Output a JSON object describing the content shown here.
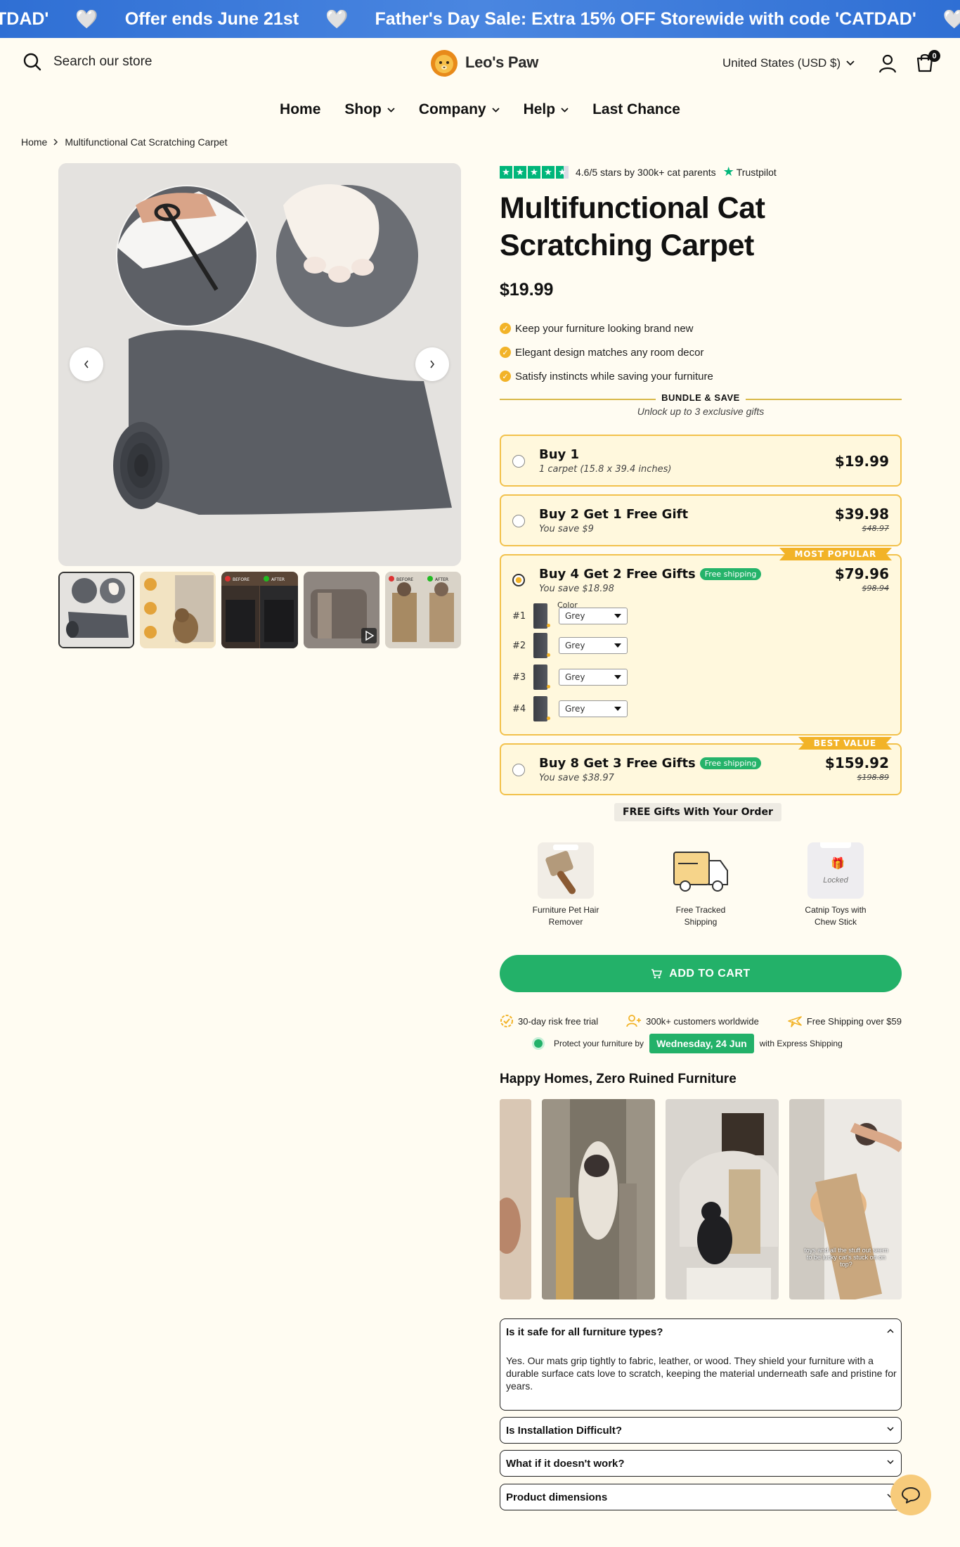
{
  "announcement": {
    "items": [
      "TDAD'",
      "Offer ends June 21st",
      "Father's Day Sale: Extra 15% OFF Storewide with code 'CATDAD'"
    ],
    "heart": "🤍"
  },
  "header": {
    "search_placeholder": "Search our store",
    "logo_text": "Leo's Paw",
    "currency": "United States (USD $)",
    "cart_count": "0"
  },
  "nav": [
    {
      "label": "Home",
      "dropdown": false
    },
    {
      "label": "Shop",
      "dropdown": true
    },
    {
      "label": "Company",
      "dropdown": true
    },
    {
      "label": "Help",
      "dropdown": true
    },
    {
      "label": "Last Chance",
      "dropdown": false
    }
  ],
  "breadcrumb": {
    "home": "Home",
    "current": "Multifunctional Cat Scratching Carpet"
  },
  "product": {
    "rating_text": "4.6/5 stars by 300k+ cat parents",
    "trustpilot": "Trustpilot",
    "title": "Multifunctional Cat Scratching Carpet",
    "price": "$19.99",
    "benefits": [
      "Keep your furniture looking brand new",
      "Elegant design matches any room decor",
      "Satisfy instincts while saving your furniture"
    ]
  },
  "bundle": {
    "title": "BUNDLE & SAVE",
    "subtitle": "Unlock up to 3 exclusive gifts",
    "options": [
      {
        "title": "Buy 1",
        "sub": "1 carpet (15.8 x 39.4 inches)",
        "price": "$19.99",
        "old": "",
        "badge": "",
        "ribbon": "",
        "selected": false
      },
      {
        "title": "Buy 2 Get 1 Free Gift",
        "sub": "You save $9",
        "price": "$39.98",
        "old": "$48.97",
        "badge": "",
        "ribbon": "",
        "selected": false
      },
      {
        "title": "Buy 4 Get 2 Free Gifts",
        "sub": "You save $18.98",
        "price": "$79.96",
        "old": "$98.94",
        "badge": "Free shipping",
        "ribbon": "MOST POPULAR",
        "selected": true
      },
      {
        "title": "Buy 8 Get 3 Free Gifts",
        "sub": "You save $38.97",
        "price": "$159.92",
        "old": "$198.89",
        "badge": "Free shipping",
        "ribbon": "BEST VALUE",
        "selected": false
      }
    ],
    "color_label": "Color",
    "variants": [
      {
        "num": "#1",
        "value": "Grey"
      },
      {
        "num": "#2",
        "value": "Grey"
      },
      {
        "num": "#3",
        "value": "Grey"
      },
      {
        "num": "#4",
        "value": "Grey"
      }
    ]
  },
  "gifts": {
    "label": "FREE Gifts With Your Order",
    "items": [
      {
        "name": "Furniture Pet Hair Remover",
        "locked": false
      },
      {
        "name": "Free Tracked Shipping",
        "locked": false
      },
      {
        "name": "Catnip Toys with Chew Stick",
        "locked": true,
        "locked_text": "Locked"
      }
    ]
  },
  "cart": {
    "add_label": "ADD TO CART"
  },
  "trust": {
    "items": [
      "30-day risk free trial",
      "300k+ customers worldwide",
      "Free Shipping over $59"
    ],
    "protect_prefix": "Protect your furniture by",
    "date": "Wednesday, 24 Jun",
    "protect_suffix": "with  Express Shipping"
  },
  "happy": {
    "title": "Happy Homes, Zero Ruined Furniture",
    "caption": "toys and all the stuff out seem to be lucky cat's stuck on on top?"
  },
  "faq": [
    {
      "q": "Is it safe for all furniture types?",
      "a": "Yes. Our mats grip tightly to fabric, leather, or wood. They shield your furniture with a durable surface cats love to scratch, keeping the material underneath safe and pristine for years.",
      "open": true
    },
    {
      "q": "Is Installation Difficult?",
      "a": "",
      "open": false
    },
    {
      "q": "What if it doesn't work?",
      "a": "",
      "open": false
    },
    {
      "q": "Product dimensions",
      "a": "",
      "open": false
    }
  ],
  "colors": {
    "accent_green": "#23b169",
    "gold": "#f2b328",
    "announce_blue": "#3a78da",
    "bg": "#fffcf2"
  }
}
